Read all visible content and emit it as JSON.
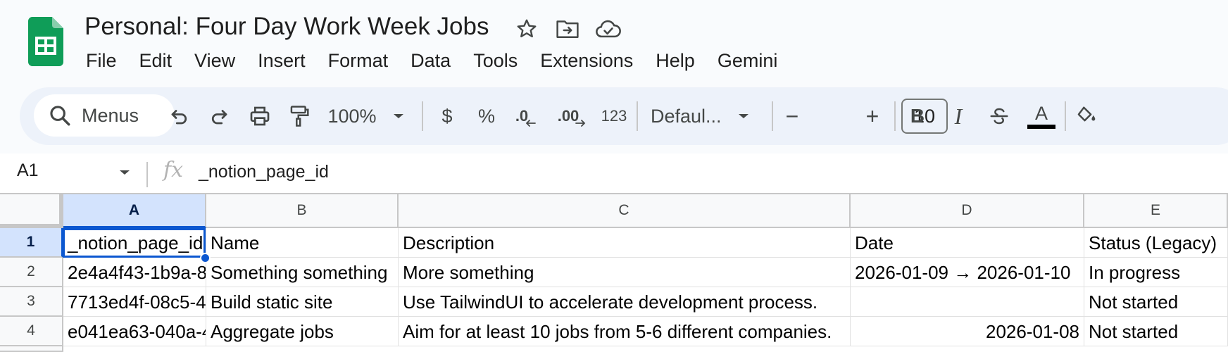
{
  "window": {
    "title": "Personal: Four Day Work Week Jobs",
    "app_icon": "sheets-logo-icon",
    "title_icons": [
      "star-icon",
      "move-folder-icon",
      "cloud-saved-icon"
    ]
  },
  "menu": {
    "items": [
      "File",
      "Edit",
      "View",
      "Insert",
      "Format",
      "Data",
      "Tools",
      "Extensions",
      "Help",
      "Gemini"
    ]
  },
  "toolbar": {
    "search_label": "Menus",
    "zoom": "100%",
    "currency": "$",
    "percent": "%",
    "decrease_decimal": ".0",
    "increase_decimal": ".00",
    "number_format": "123",
    "font": "Defaul...",
    "font_size": "10",
    "minus": "−",
    "plus": "+",
    "bold": "B",
    "italic": "I",
    "text_color_label": "A"
  },
  "formula_bar": {
    "cell_ref": "A1",
    "fx": "fx",
    "content": "_notion_page_id"
  },
  "sheet": {
    "columns": [
      "A",
      "B",
      "C",
      "D",
      "E"
    ],
    "rows": [
      {
        "num": "1",
        "cells": [
          "_notion_page_id",
          "Name",
          "Description",
          "Date",
          "Status (Legacy)"
        ]
      },
      {
        "num": "2",
        "cells": [
          "2e4a4f43-1b9a-8",
          "Something something",
          "More something",
          "2026-01-09 → 2026-01-10",
          "In progress"
        ]
      },
      {
        "num": "3",
        "cells": [
          "7713ed4f-08c5-4",
          "Build static site",
          "Use TailwindUI to accelerate development process.",
          "",
          "Not started"
        ]
      },
      {
        "num": "4",
        "cells": [
          "e041ea63-040a-4",
          "Aggregate jobs",
          "Aim for at least 10 jobs from 5-6 different companies.",
          "2026-01-08",
          "Not started"
        ]
      }
    ]
  },
  "colors": {
    "sheets_green": "#0f9d58",
    "selection_blue": "#0b57d0",
    "toolbar_bg": "#edf2fa",
    "header_selected": "#d3e3fd"
  }
}
